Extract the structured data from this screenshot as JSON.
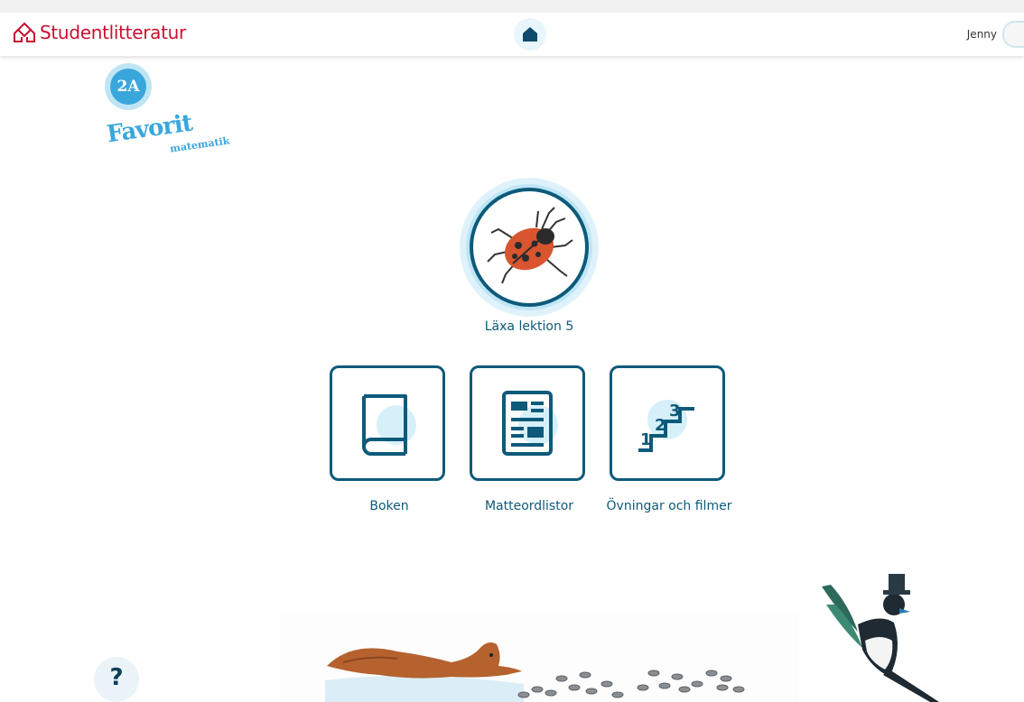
{
  "header": {
    "brand": "Studentlitteratur",
    "home_icon": "home-icon",
    "user_name": "Jenny"
  },
  "logo": {
    "grade": "2A",
    "title": "Favorit",
    "subtitle": "matematik"
  },
  "lesson": {
    "label": "Läxa lektion 5",
    "icon": "ladybug-illustration"
  },
  "tiles": [
    {
      "label": "Boken",
      "icon": "book-icon"
    },
    {
      "label": "Matteordlistor",
      "icon": "wordlist-icon"
    },
    {
      "label": "Övningar och filmer",
      "icon": "stairs-123-icon"
    }
  ],
  "help": {
    "label": "?"
  },
  "colors": {
    "brand_red": "#c8102e",
    "primary": "#0e5a7a",
    "accent_light": "#d6f0fa",
    "logo_blue": "#3aa7dc"
  }
}
